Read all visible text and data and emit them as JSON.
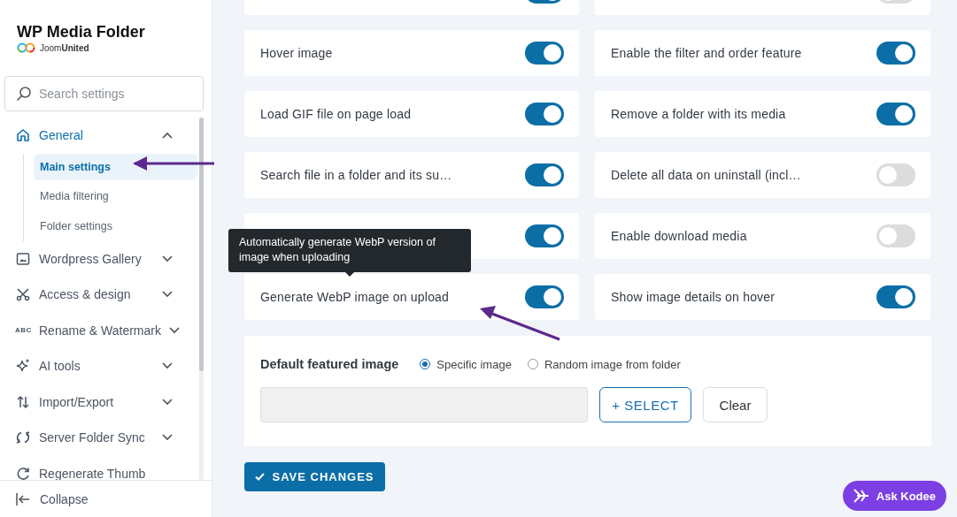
{
  "sidebar": {
    "title": "WP Media Folder",
    "brand": {
      "light": "Joom",
      "bold": "United"
    },
    "search": {
      "placeholder": "Search settings"
    },
    "nav": [
      {
        "kind": "group",
        "label": "General",
        "expanded": true,
        "active": true,
        "children": [
          {
            "label": "Main settings",
            "selected": true
          },
          {
            "label": "Media filtering",
            "selected": false
          },
          {
            "label": "Folder settings",
            "selected": false
          }
        ]
      },
      {
        "kind": "group",
        "label": "Wordpress Gallery",
        "expanded": false,
        "active": false
      },
      {
        "kind": "group",
        "label": "Access & design",
        "expanded": false,
        "active": false
      },
      {
        "kind": "group",
        "label": "Rename & Watermark",
        "expanded": false,
        "active": false,
        "icon_text": "ABC"
      },
      {
        "kind": "group",
        "label": "AI tools",
        "expanded": false,
        "active": false
      },
      {
        "kind": "group",
        "label": "Import/Export",
        "expanded": false,
        "active": false
      },
      {
        "kind": "group",
        "label": "Server Folder Sync",
        "expanded": false,
        "active": false
      },
      {
        "kind": "link",
        "label": "Regenerate Thumb",
        "active": false
      }
    ],
    "collapse": "Collapse"
  },
  "settings": [
    {
      "on": true
    },
    {
      "on": false
    },
    {
      "label": "Hover image",
      "on": true
    },
    {
      "label": "Enable the filter and order feature",
      "on": true
    },
    {
      "label": "Load GIF file on page load",
      "on": true
    },
    {
      "label": "Remove a folder with its media",
      "on": true
    },
    {
      "label": "Search file in a folder and its su…",
      "on": true
    },
    {
      "label": "Delete all data on uninstall (incl…",
      "on": false
    },
    {
      "on": true
    },
    {
      "label": "Enable download media",
      "on": false
    },
    {
      "label": "Generate WebP image on upload",
      "on": true
    },
    {
      "label": "Show image details on hover",
      "on": true
    }
  ],
  "tooltip": "Automatically generate WebP version of image when uploading",
  "featured": {
    "label": "Default featured image",
    "options": [
      {
        "label": "Specific image",
        "selected": true
      },
      {
        "label": "Random image from folder",
        "selected": false
      }
    ],
    "select_button": "+ SELECT",
    "clear_button": "Clear"
  },
  "save_button": "SAVE CHANGES",
  "assistant_button": "Ask Kodee"
}
